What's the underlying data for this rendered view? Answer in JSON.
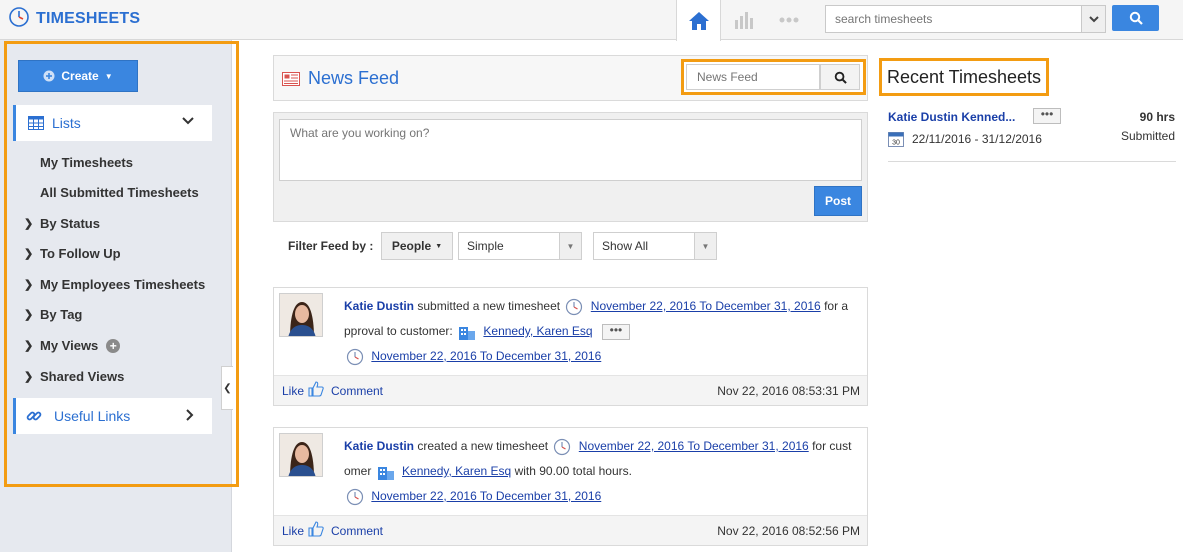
{
  "app": {
    "title": "TIMESHEETS"
  },
  "topbar": {
    "icons": [
      "home-icon",
      "chart-icon",
      "more-icon"
    ],
    "search_placeholder": "search timesheets"
  },
  "sidebar": {
    "create_label": "Create",
    "lists_label": "Lists",
    "items": [
      {
        "label": "My Timesheets",
        "type": "sub"
      },
      {
        "label": "All Submitted Timesheets",
        "type": "sub"
      },
      {
        "label": "By Status",
        "type": "expand"
      },
      {
        "label": "To Follow Up",
        "type": "expand"
      },
      {
        "label": "My Employees Timesheets",
        "type": "expand"
      },
      {
        "label": "By Tag",
        "type": "expand"
      },
      {
        "label": "My Views",
        "type": "expand"
      },
      {
        "label": "Shared Views",
        "type": "expand"
      }
    ],
    "useful_links_label": "Useful Links"
  },
  "feed": {
    "title": "News Feed",
    "search_placeholder": "News Feed",
    "composer_placeholder": "What are you working on?",
    "post_label": "Post",
    "filter_label": "Filter Feed by :",
    "filter_people": "People",
    "filter_type": "Simple",
    "filter_show": "Show All",
    "items": [
      {
        "user": "Katie Dustin",
        "action": "submitted a new timesheet",
        "link1": "November 22, 2016 To December 31, 2016",
        "mid": "for a pproval to customer:",
        "customer": "Kennedy, Karen Esq",
        "after_customer": "",
        "link2": "November 22, 2016 To December 31, 2016",
        "like": "Like",
        "comment": "Comment",
        "time": "Nov 22, 2016 08:53:31 PM"
      },
      {
        "user": "Katie Dustin",
        "action": "created a new timesheet",
        "link1": "November 22, 2016 To December 31, 2016",
        "mid": "for cust omer",
        "customer": "Kennedy, Karen Esq",
        "after_customer": "with 90.00 total hours.",
        "link2": "November 22, 2016 To December 31, 2016",
        "like": "Like",
        "comment": "Comment",
        "time": "Nov 22, 2016 08:52:56 PM"
      }
    ]
  },
  "recent": {
    "title": "Recent Timesheets",
    "name": "Katie Dustin Kenned...",
    "hours": "90 hrs",
    "dates": "22/11/2016 - 31/12/2016",
    "status": "Submitted",
    "calendar_day": "30"
  },
  "colors": {
    "accent": "#3a86e0",
    "highlight": "#f39c12",
    "link": "#1a3fa8"
  }
}
